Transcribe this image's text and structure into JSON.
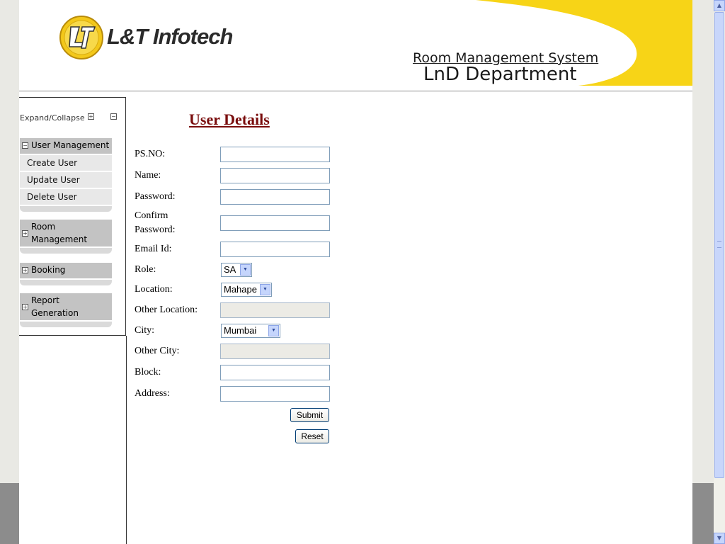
{
  "header": {
    "brand": "L&T Infotech",
    "system_title": "Room Management System",
    "department": "LnD Department"
  },
  "sidebar": {
    "expand_collapse": "Expand/Collapse",
    "menus": [
      {
        "title": "User Management",
        "expanded": true,
        "items": [
          "Create User",
          "Update User",
          "Delete User"
        ]
      },
      {
        "title_line1": "Room",
        "title_line2": "Management",
        "expanded": false
      },
      {
        "title": "Booking",
        "expanded": false
      },
      {
        "title_line1": "Report",
        "title_line2": "Generation",
        "expanded": false
      }
    ]
  },
  "form": {
    "title": "User Details",
    "labels": {
      "psno": "PS.NO:",
      "name": "Name:",
      "password": "Password:",
      "confirm_line1": "Confirm",
      "confirm_line2": "Password:",
      "email": "Email Id:",
      "role": "Role:",
      "location": "Location:",
      "other_location": "Other Location:",
      "city": "City:",
      "other_city": "Other City:",
      "block": "Block:",
      "address": "Address:"
    },
    "values": {
      "role": "SA",
      "location": "Mahape",
      "city": "Mumbai"
    },
    "buttons": {
      "submit": "Submit",
      "reset": "Reset"
    }
  },
  "colors": {
    "accent_yellow": "#f7d417",
    "title_red": "#7a0d0d",
    "menu_gray": "#c3c3c3"
  }
}
